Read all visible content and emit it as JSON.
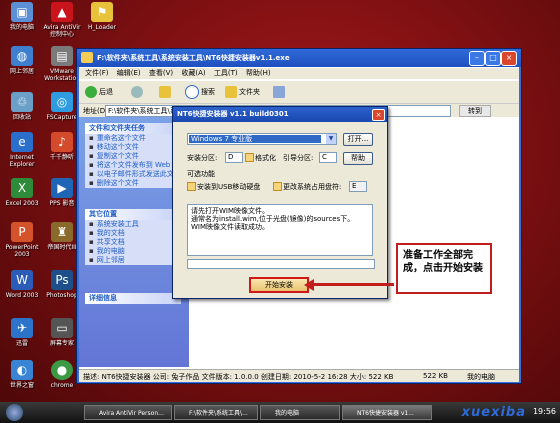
{
  "desktop_icons": [
    {
      "label": "我的电脑",
      "icon": "computer-icon"
    },
    {
      "label": "Avira AntiVir 控制中心",
      "icon": "avira-icon"
    },
    {
      "label": "H_Loader",
      "icon": "loader-icon"
    },
    {
      "label": "网上邻居",
      "icon": "network-icon"
    },
    {
      "label": "VMware Workstation",
      "icon": "vmware-icon"
    },
    {
      "label": "回收站",
      "icon": "recycle-bin-icon"
    },
    {
      "label": "FSCapture",
      "icon": "fscapture-icon"
    },
    {
      "label": "Internet Explorer",
      "icon": "ie-icon"
    },
    {
      "label": "千千静听",
      "icon": "ttplayer-icon"
    },
    {
      "label": "Excel 2003",
      "icon": "excel-icon"
    },
    {
      "label": "PPS 影音",
      "icon": "pps-icon"
    },
    {
      "label": "PowerPoint 2003",
      "icon": "powerpoint-icon"
    },
    {
      "label": "帝国时代III",
      "icon": "game-icon"
    },
    {
      "label": "Word 2003",
      "icon": "word-icon"
    },
    {
      "label": "Photoshop",
      "icon": "photoshop-icon"
    },
    {
      "label": "迅雷",
      "icon": "thunder-icon"
    },
    {
      "label": "屏幕专家",
      "icon": "screen-icon"
    },
    {
      "label": "世界之窗",
      "icon": "browser-icon"
    },
    {
      "label": "chrome",
      "icon": "chrome-icon"
    }
  ],
  "explorer": {
    "title": "F:\\软件夹\\系统工具\\系统安装工具\\NT6快捷安装器v1.1.exe",
    "menu": [
      "文件(F)",
      "编辑(E)",
      "查看(V)",
      "收藏(A)",
      "工具(T)",
      "帮助(H)"
    ],
    "toolbar": {
      "back": "后退",
      "search": "搜索",
      "folders": "文件夹"
    },
    "address_label": "地址(D)",
    "address_value": "F:\\软件夹\\系统工具\\系统安装工具",
    "go_label": "转到",
    "file_tasks": {
      "title": "文件和文件夹任务",
      "items": [
        "重命名这个文件",
        "移动这个文件",
        "复制这个文件",
        "将这个文件发布到 Web",
        "以电子邮件形式发送此文件",
        "删除这个文件"
      ]
    },
    "other_places": {
      "title": "其它位置",
      "items": [
        "系统安装工具",
        "我的文档",
        "共享文档",
        "我的电脑",
        "网上邻居"
      ]
    },
    "details": {
      "title": "详细信息"
    },
    "status": {
      "description": "描述: NT6快捷安装器 公司: 兔子作品 文件版本: 1.0.0.0 创建日期: 2010-5-2 16:28 大小: 522 KB",
      "size": "522 KB",
      "location": "我的电脑"
    }
  },
  "dialog": {
    "title": "NT6快捷安装器 v1.1 build0301",
    "system_selected": "Windows 7 专业版",
    "open_button": "打开...",
    "install_partition_label": "安装分区:",
    "install_partition_value": "D",
    "format_label": "格式化",
    "boot_partition_label": "引导分区:",
    "boot_partition_value": "C",
    "help_button": "帮助",
    "optional_label": "可选功能",
    "usb_label": "安装到USB移动硬盘",
    "change_drive_label": "更改系统占用盘符:",
    "change_drive_value": "E",
    "message": "请先打开WIM映像文件。\n通常名为install.wim,位于光盘(镜像)的sources下。\nWIM映像文件读取成功。",
    "start_button": "开始安装"
  },
  "callout": {
    "text": "准备工作全部完成，点击开始安装"
  },
  "taskbar": {
    "items": [
      "Avira AntiVir Person...",
      "F:\\软件夹\\系统工具\\...",
      "我的电脑",
      "NT6快捷安装器 v1..."
    ],
    "clock": "19:56",
    "watermark": "xuexiba"
  },
  "colors": {
    "highlight": "#316ac5",
    "callout_border": "#c21d1d",
    "titlebar": "#2f6bd8"
  }
}
